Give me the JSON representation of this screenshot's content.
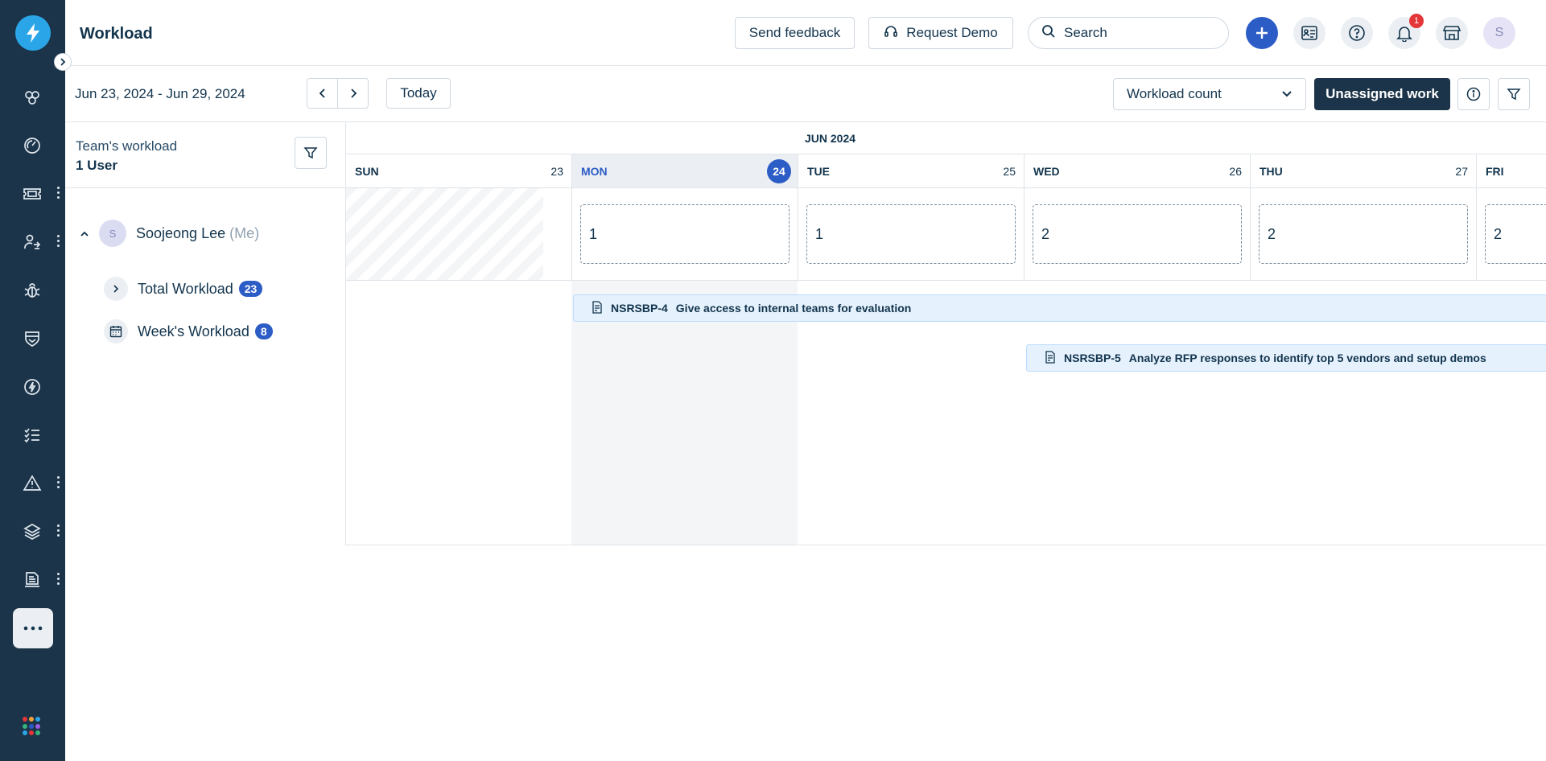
{
  "header": {
    "title": "Workload",
    "send_feedback": "Send feedback",
    "request_demo": "Request Demo",
    "search_placeholder": "Search",
    "notification_count": "1",
    "avatar_initial": "S"
  },
  "toolbar": {
    "date_range": "Jun 23, 2024 - Jun 29, 2024",
    "today": "Today",
    "view_select": "Workload count",
    "unassigned": "Unassigned work"
  },
  "panel": {
    "title": "Team's workload",
    "count": "1 User",
    "user": {
      "initial": "S",
      "name": "Soojeong Lee",
      "me": "(Me)"
    },
    "total_label": "Total Workload",
    "total_count": "23",
    "week_label": "Week's Workload",
    "week_count": "8"
  },
  "calendar": {
    "month": "JUN 2024",
    "days": [
      {
        "name": "SUN",
        "date": "23",
        "count": ""
      },
      {
        "name": "MON",
        "date": "24",
        "count": "1",
        "today": true
      },
      {
        "name": "TUE",
        "date": "25",
        "count": "1"
      },
      {
        "name": "WED",
        "date": "26",
        "count": "2"
      },
      {
        "name": "THU",
        "date": "27",
        "count": "2"
      },
      {
        "name": "FRI",
        "date": "",
        "count": "2"
      }
    ],
    "tasks": [
      {
        "id": "NSRSBP-4",
        "title": "Give access to internal teams for evaluation"
      },
      {
        "id": "NSRSBP-5",
        "title": "Analyze RFP responses to identify top 5 vendors and setup demos"
      }
    ]
  },
  "colors": {
    "rail": "#1c3449",
    "accent": "#2c5cc5",
    "logo": "#2aa6e8",
    "task_bg": "#e5f2fd",
    "badge": "#e43538"
  }
}
